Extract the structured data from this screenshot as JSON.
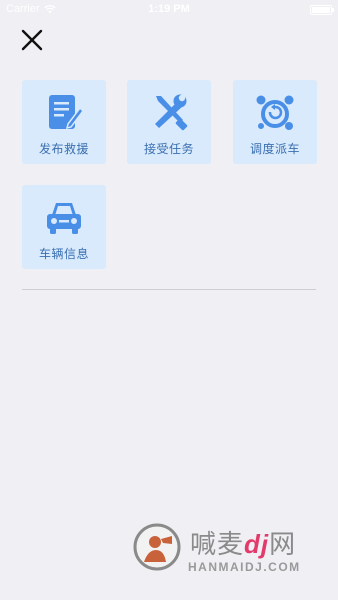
{
  "status_bar": {
    "carrier": "Carrier",
    "time": "1:19 PM",
    "wifi_icon": "wifi-icon",
    "battery_icon": "battery-icon"
  },
  "header": {
    "close_icon": "close-icon"
  },
  "menu": {
    "items": [
      {
        "label": "发布救援",
        "icon": "document-edit-icon"
      },
      {
        "label": "接受任务",
        "icon": "tools-icon"
      },
      {
        "label": "调度派车",
        "icon": "dispatch-icon"
      },
      {
        "label": "车辆信息",
        "icon": "car-icon"
      }
    ],
    "tile_color": "#d8eafc",
    "icon_color": "#4a8fe7",
    "label_color": "#3a6fb1"
  },
  "watermark": {
    "text_cn": "喊麦",
    "brand_mark": "dj",
    "text_suffix": "网",
    "text_en": "HANMAIDJ.COM"
  }
}
